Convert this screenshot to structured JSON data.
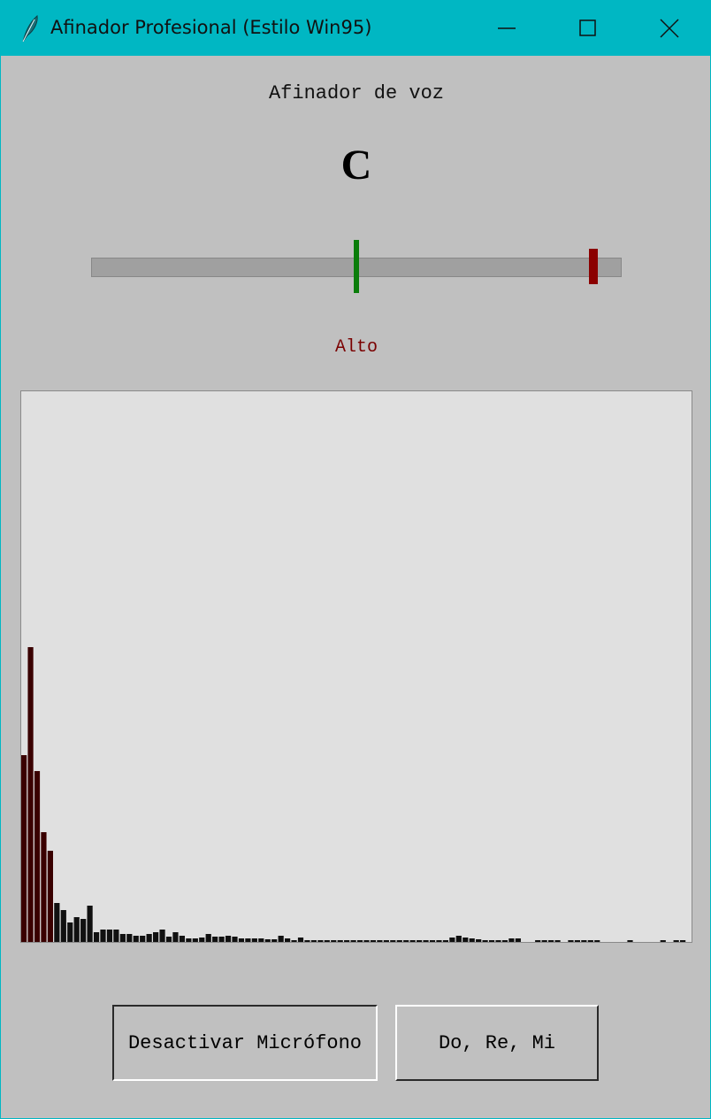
{
  "window": {
    "title": "Afinador Profesional (Estilo Win95)",
    "icons": {
      "app": "feather-icon",
      "minimize": "minimize-icon",
      "maximize": "maximize-icon",
      "close": "close-icon"
    }
  },
  "tuner": {
    "header": "Afinador de voz",
    "note": "C",
    "status": "Alto",
    "pointer_fraction": 0.95,
    "colors": {
      "center": "#0a7d0a",
      "pointer": "#8b0000",
      "status": "#7a0000"
    }
  },
  "spectrum": {
    "peak_color": "#3a0000",
    "bar_color": "#111111",
    "colored_bars": 5,
    "bars": [
      0.34,
      0.535,
      0.31,
      0.2,
      0.165,
      0.07,
      0.058,
      0.035,
      0.045,
      0.042,
      0.066,
      0.018,
      0.022,
      0.022,
      0.022,
      0.015,
      0.015,
      0.012,
      0.012,
      0.015,
      0.018,
      0.022,
      0.01,
      0.018,
      0.012,
      0.006,
      0.006,
      0.008,
      0.015,
      0.01,
      0.01,
      0.012,
      0.01,
      0.006,
      0.006,
      0.006,
      0.006,
      0.005,
      0.005,
      0.012,
      0.006,
      0.004,
      0.008,
      0.004,
      0.004,
      0.004,
      0.004,
      0.004,
      0.004,
      0.004,
      0.004,
      0.004,
      0.004,
      0.004,
      0.004,
      0.004,
      0.004,
      0.004,
      0.004,
      0.004,
      0.004,
      0.004,
      0.004,
      0.004,
      0.004,
      0.008,
      0.012,
      0.008,
      0.006,
      0.005,
      0.004,
      0.004,
      0.004,
      0.004,
      0.006,
      0.006,
      0.0,
      0.0,
      0.003,
      0.003,
      0.003,
      0.003,
      0.0,
      0.003,
      0.003,
      0.003,
      0.003,
      0.003,
      0.0,
      0.0,
      0.0,
      0.0,
      0.003,
      0.0,
      0.0,
      0.0,
      0.0,
      0.003,
      0.0,
      0.003,
      0.003
    ]
  },
  "buttons": {
    "mic": "Desactivar Micrófono",
    "scale": "Do, Re, Mi"
  }
}
